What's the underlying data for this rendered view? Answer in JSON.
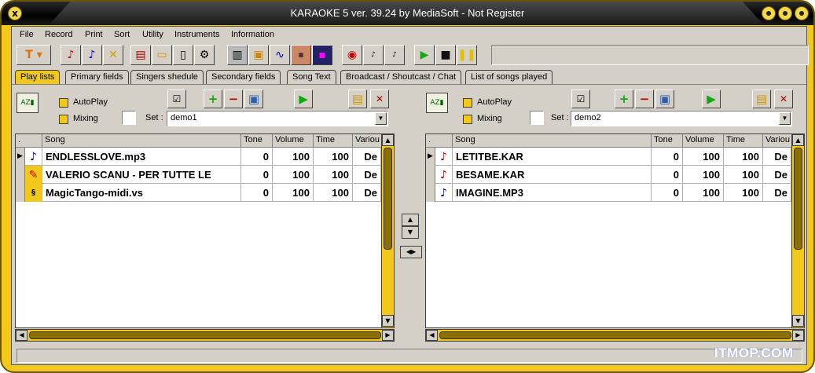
{
  "window": {
    "title": "KARAOKE 5    ver. 39.24 by MediaSoft - Not Register",
    "close_glyph": "x"
  },
  "menu": [
    "File",
    "Record",
    "Print",
    "Sort",
    "Utility",
    "Instruments",
    "Information"
  ],
  "toolbar": {
    "icons": [
      "karaoke-dropdown-icon",
      "note-red-icon",
      "note-blue-icon",
      "tools-icon",
      "add-file-icon",
      "open-folder-icon",
      "document-icon",
      "settings-icon",
      "keyboard-icon",
      "image-icon",
      "wave-icon",
      "animated-icon",
      "tv-icon",
      "record-icon",
      "k5-1-icon",
      "k5-2-icon",
      "play-icon",
      "stop-icon",
      "pause-icon"
    ]
  },
  "tabs": [
    "Play lists",
    "Primary fields",
    "Singers shedule",
    "Secondary fields",
    "Song Text",
    "Broadcast / Shoutcast / Chat",
    "List of songs played"
  ],
  "active_tab": "Play lists",
  "left_panel": {
    "autoplay_label": "AutoPlay",
    "mixing_label": "Mixing",
    "set_label": "Set :",
    "set_value": "demo1",
    "columns": [
      ".",
      "Song",
      "Tone",
      "Volume",
      "Time",
      "Variou"
    ],
    "rows": [
      {
        "icon": "mp3-note-icon",
        "song": "ENDLESSLOVE.mp3",
        "tone": "0",
        "volume": "100",
        "time": "100",
        "various": "De"
      },
      {
        "icon": "video-icon",
        "song": "VALERIO SCANU - PER TUTTE LE",
        "tone": "0",
        "volume": "100",
        "time": "100",
        "various": "De"
      },
      {
        "icon": "midi-vs-icon",
        "song": "MagicTango-midi.vs",
        "tone": "0",
        "volume": "100",
        "time": "100",
        "various": "De"
      }
    ]
  },
  "right_panel": {
    "autoplay_label": "AutoPlay",
    "mixing_label": "Mixing",
    "set_label": "Set :",
    "set_value": "demo2",
    "columns": [
      ".",
      "Song",
      "Tone",
      "Volume",
      "Time",
      "Variou"
    ],
    "rows": [
      {
        "icon": "kar-note-icon",
        "song": "LETITBE.KAR",
        "tone": "0",
        "volume": "100",
        "time": "100",
        "various": "De"
      },
      {
        "icon": "kar-note-icon",
        "song": "BESAME.KAR",
        "tone": "0",
        "volume": "100",
        "time": "100",
        "various": "De"
      },
      {
        "icon": "mp3-note-icon",
        "song": "IMAGINE.MP3",
        "tone": "0",
        "volume": "100",
        "time": "100",
        "various": "De"
      }
    ]
  },
  "watermark": "ITMOP.COM",
  "colors": {
    "frame": "#f2c91a",
    "titlebar": "#000000",
    "accent_green": "#22aa22",
    "accent_red": "#cc2222"
  }
}
